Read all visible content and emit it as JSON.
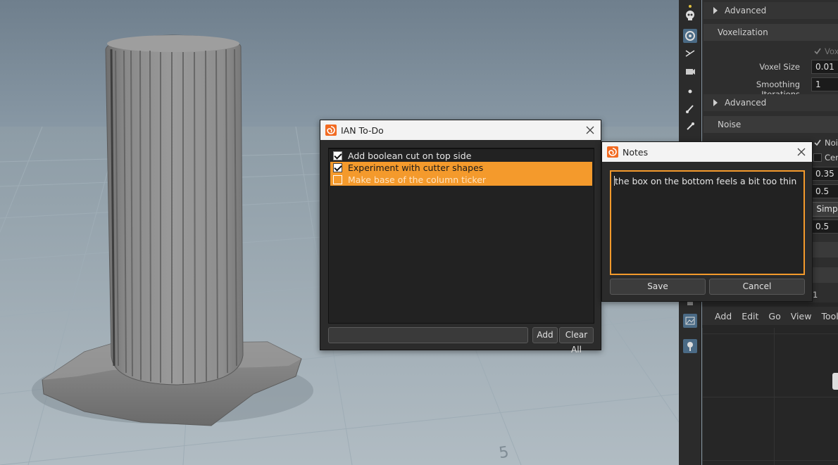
{
  "viewport": {
    "ground_label": "5"
  },
  "params": {
    "advanced_1": "Advanced",
    "voxelization": "Voxelization",
    "voxelize_label": "Vox",
    "voxel_size_label": "Voxel Size",
    "voxel_size_value": "0.01",
    "smoothing_label": "Smoothing Iterations",
    "smoothing_value": "1",
    "advanced_2": "Advanced",
    "noise": "Noise",
    "noise_toggle_label": "Nois",
    "center_label": "Cen",
    "value_035": "0.35",
    "value_05a": "0.5",
    "simp_button": "Simp",
    "value_05b": "0.5",
    "value_1": "1"
  },
  "network": {
    "menu": [
      "Add",
      "Edit",
      "Go",
      "View",
      "Tools"
    ]
  },
  "todo": {
    "title": "IAN To-Do",
    "items": [
      {
        "label": "Add boolean cut on top side",
        "checked": true,
        "selected": false
      },
      {
        "label": "Experiment with cutter shapes",
        "checked": true,
        "selected": true
      },
      {
        "label": "Make base of the column ticker",
        "checked": false,
        "selected": true
      }
    ],
    "input_value": "",
    "add_label": "Add",
    "clear_label": "Clear All"
  },
  "notes": {
    "title": "Notes",
    "text": "the box on the bottom feels a bit too thin",
    "save_label": "Save",
    "cancel_label": "Cancel"
  },
  "colors": {
    "accent": "#f49a2c",
    "selection_bg": "#4a6a85"
  }
}
